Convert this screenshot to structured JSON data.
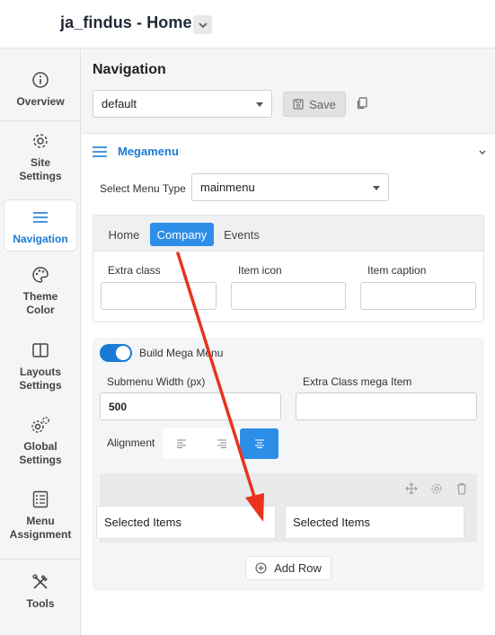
{
  "app": {
    "title": "ja_findus - Home"
  },
  "sidebar": {
    "items": [
      {
        "label": "Overview",
        "icon": "info-icon"
      },
      {
        "label": "Site\nSettings",
        "icon": "gear-icon"
      },
      {
        "label": "Navigation",
        "icon": "hamburger-icon",
        "active": true
      },
      {
        "label": "Theme\nColor",
        "icon": "palette-icon"
      },
      {
        "label": "Layouts\nSettings",
        "icon": "layout-icon"
      },
      {
        "label": "Global\nSettings",
        "icon": "gears-icon"
      },
      {
        "label": "Menu\nAssignment",
        "icon": "list-icon"
      },
      {
        "label": "Tools",
        "icon": "tools-icon"
      }
    ]
  },
  "navigation": {
    "title": "Navigation",
    "preset_value": "default",
    "save_label": "Save"
  },
  "megamenu": {
    "title": "Megamenu",
    "menu_type_label": "Select Menu Type",
    "menu_type_value": "mainmenu",
    "tabs": [
      {
        "label": "Home"
      },
      {
        "label": "Company",
        "active": true
      },
      {
        "label": "Events"
      }
    ],
    "fields": {
      "extra_class_label": "Extra class",
      "item_icon_label": "Item icon",
      "item_caption_label": "Item caption"
    },
    "build_mega_menu_label": "Build Mega Menu",
    "build_mega_menu_on": true,
    "submenu_width_label": "Submenu Width (px)",
    "submenu_width_value": "500",
    "extra_class_mega_label": "Extra Class mega Item",
    "alignment_label": "Alignment",
    "alignment_selected": "center",
    "columns": [
      {
        "label": "Selected Items"
      },
      {
        "label": "Selected Items"
      }
    ],
    "add_row_label": "Add Row"
  },
  "colors": {
    "accent": "#1a7bd6",
    "tab_active": "#2d8ee8",
    "annotation_arrow": "#e8341c"
  }
}
